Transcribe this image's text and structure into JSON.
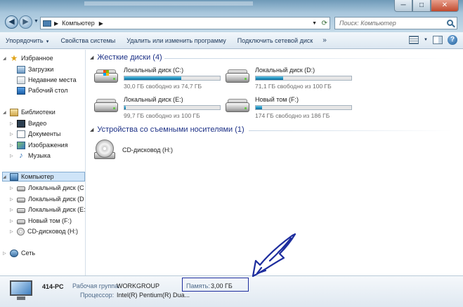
{
  "window": {
    "address_path": "Компьютер",
    "search_placeholder": "Поиск: Компьютер",
    "controls": {
      "minimize": "─",
      "maximize": "□",
      "close": "✕"
    }
  },
  "commandbar": {
    "items": [
      {
        "label": "Упорядочить",
        "has_dropdown": true
      },
      {
        "label": "Свойства системы"
      },
      {
        "label": "Удалить или изменить программу"
      },
      {
        "label": "Подключить сетевой диск"
      }
    ],
    "more": "»",
    "help": "?"
  },
  "navigation": {
    "favorites": {
      "label": "Избранное",
      "items": [
        {
          "label": "Загрузки",
          "icon": "download-icon"
        },
        {
          "label": "Недавние места",
          "icon": "recent-places-icon"
        },
        {
          "label": "Рабочий стол",
          "icon": "desktop-icon"
        }
      ]
    },
    "libraries": {
      "label": "Библиотеки",
      "items": [
        {
          "label": "Видео",
          "icon": "video-icon"
        },
        {
          "label": "Документы",
          "icon": "documents-icon"
        },
        {
          "label": "Изображения",
          "icon": "images-icon"
        },
        {
          "label": "Музыка",
          "icon": "music-icon"
        }
      ]
    },
    "computer": {
      "label": "Компьютер",
      "items": [
        {
          "label": "Локальный диск (C",
          "icon": "drive-icon"
        },
        {
          "label": "Локальный диск (D",
          "icon": "drive-icon"
        },
        {
          "label": "Локальный диск (E:",
          "icon": "drive-icon"
        },
        {
          "label": "Новый том (F:)",
          "icon": "drive-icon"
        },
        {
          "label": "CD-дисковод (H:)",
          "icon": "cd-drive-icon"
        }
      ]
    },
    "network": {
      "label": "Сеть"
    }
  },
  "content": {
    "hard_drives": {
      "header": "Жесткие диски (4)",
      "drives": [
        {
          "name": "Локальный диск (C:)",
          "free": "30,0 ГБ свободно из 74,7 ГБ",
          "used_fraction": 0.598,
          "system": true
        },
        {
          "name": "Локальный диск (D:)",
          "free": "71,1 ГБ свободно из 100 ГБ",
          "used_fraction": 0.289,
          "system": false
        },
        {
          "name": "Локальный диск (E:)",
          "free": "99,7 ГБ свободно из 100 ГБ",
          "used_fraction": 0.003,
          "system": false
        },
        {
          "name": "Новый том (F:)",
          "free": "174 ГБ свободно из 186 ГБ",
          "used_fraction": 0.065,
          "system": false
        }
      ]
    },
    "removable": {
      "header": "Устройства со съемными носителями (1)",
      "devices": [
        {
          "name": "CD-дисковод (H:)"
        }
      ]
    }
  },
  "details": {
    "computer_name": "414-PC",
    "workgroup_label": "Рабочая группа:",
    "workgroup_value": "WORKGROUP",
    "memory_label": "Память:",
    "memory_value": "3,00 ГБ",
    "processor_label": "Процессор:",
    "processor_value": "Intel(R) Pentium(R) Dua..."
  },
  "annotation": {
    "color": "#1d2d9e"
  }
}
